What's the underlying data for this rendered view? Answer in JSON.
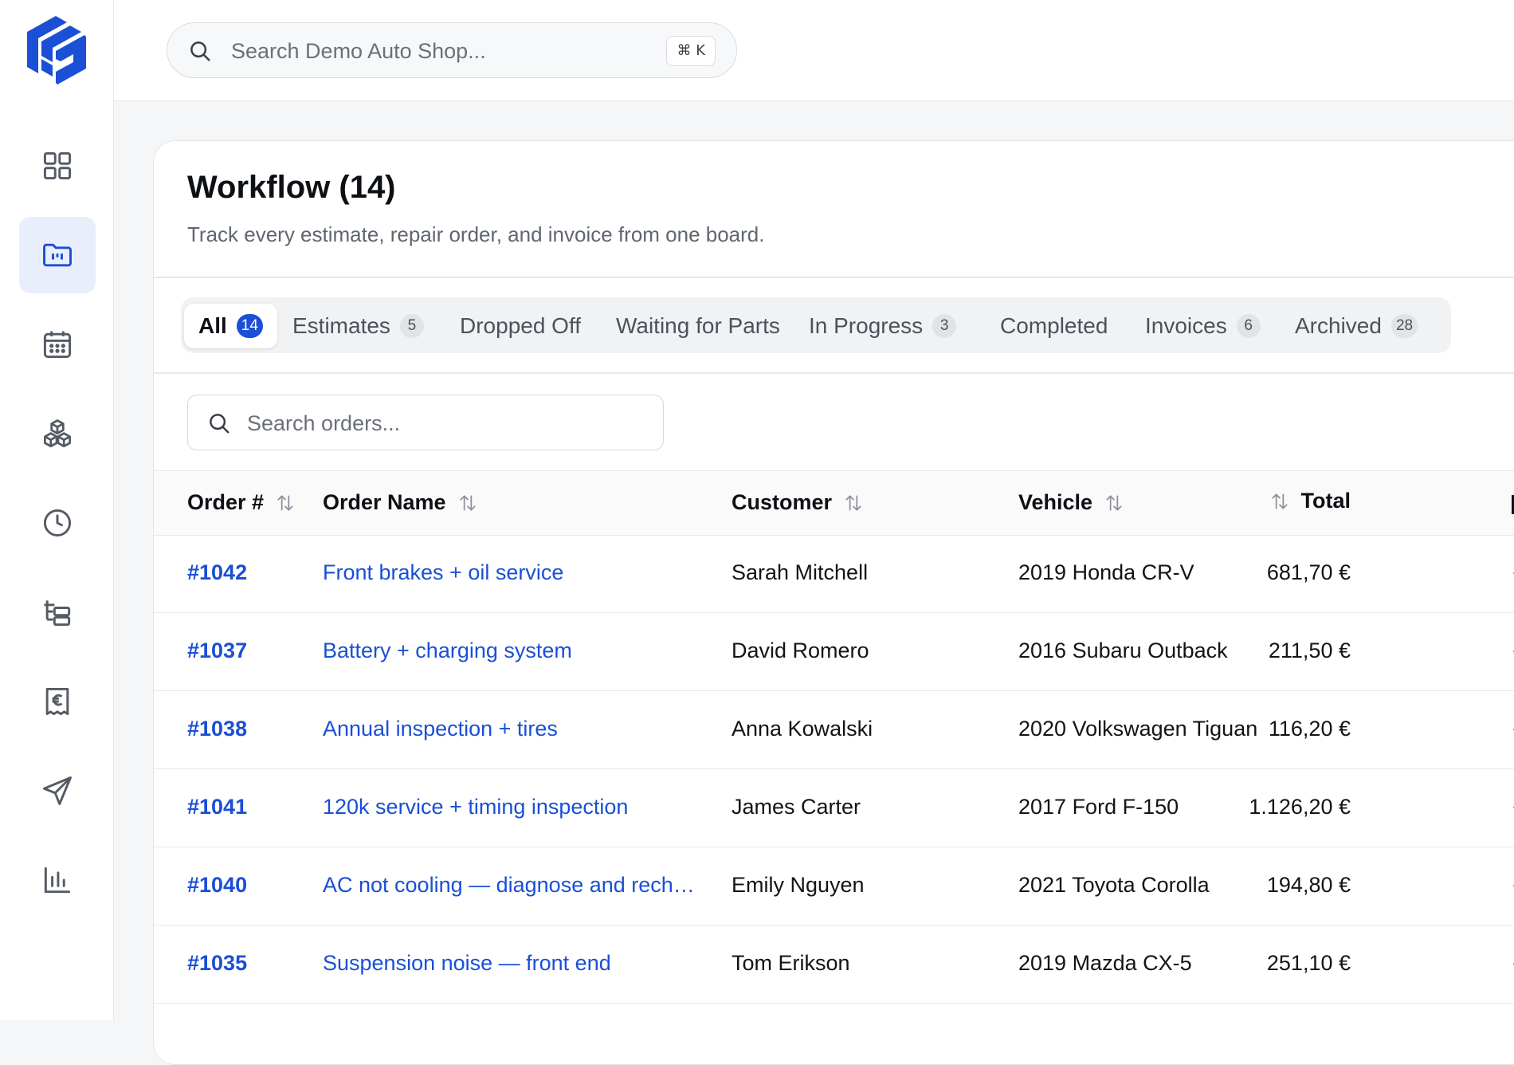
{
  "app": {
    "name": "Demo Auto Shop"
  },
  "colors": {
    "accent": "#1a4fd6",
    "active_nav_bg": "#e8eefc"
  },
  "sidebar": {
    "logo_icon": "brand-logo-icon",
    "items": [
      {
        "icon": "dashboard-grid-icon",
        "active": false
      },
      {
        "icon": "workflow-folder-icon",
        "active": true
      },
      {
        "icon": "calendar-icon",
        "active": false
      },
      {
        "icon": "inventory-boxes-icon",
        "active": false
      },
      {
        "icon": "clock-icon",
        "active": false
      },
      {
        "icon": "hierarchy-icon",
        "active": false
      },
      {
        "icon": "euro-receipt-icon",
        "active": false
      },
      {
        "icon": "send-icon",
        "active": false
      },
      {
        "icon": "reports-chart-icon",
        "active": false
      }
    ]
  },
  "topbar": {
    "search_placeholder": "Search Demo Auto Shop...",
    "shortcut": "⌘ K"
  },
  "page": {
    "title": "Workflow (14)",
    "subtitle": "Track every estimate, repair order, and invoice from one board."
  },
  "tabs": [
    {
      "label": "All",
      "count": "14",
      "active": true
    },
    {
      "label": "Estimates",
      "count": "5",
      "active": false
    },
    {
      "label": "Dropped Off",
      "count": "",
      "active": false
    },
    {
      "label": "Waiting for Parts",
      "count": "",
      "active": false
    },
    {
      "label": "In Progress",
      "count": "3",
      "active": false
    },
    {
      "label": "Completed",
      "count": "",
      "active": false
    },
    {
      "label": "Invoices",
      "count": "6",
      "active": false
    },
    {
      "label": "Archived",
      "count": "28",
      "active": false
    }
  ],
  "order_search": {
    "placeholder": "Search orders..."
  },
  "table": {
    "columns": {
      "order": "Order #",
      "name": "Order Name",
      "customer": "Customer",
      "vehicle": "Vehicle",
      "total": "Total"
    },
    "rows": [
      {
        "order": "#1042",
        "name": "Front brakes + oil service",
        "customer": "Sarah Mitchell",
        "vehicle": "2019 Honda CR-V",
        "total": "681,70 €"
      },
      {
        "order": "#1037",
        "name": "Battery + charging system",
        "customer": "David Romero",
        "vehicle": "2016 Subaru Outback",
        "total": "211,50 €"
      },
      {
        "order": "#1038",
        "name": "Annual inspection + tires",
        "customer": "Anna Kowalski",
        "vehicle": "2020 Volkswagen Tiguan",
        "total": "116,20 €"
      },
      {
        "order": "#1041",
        "name": "120k service + timing inspection",
        "customer": "James Carter",
        "vehicle": "2017 Ford F-150",
        "total": "1.126,20 €"
      },
      {
        "order": "#1040",
        "name": "AC not cooling — diagnose and recharge",
        "customer": "Emily Nguyen",
        "vehicle": "2021 Toyota Corolla",
        "total": "194,80 €"
      },
      {
        "order": "#1035",
        "name": "Suspension noise — front end",
        "customer": "Tom Erikson",
        "vehicle": "2019 Mazda CX-5",
        "total": "251,10 €"
      }
    ]
  }
}
